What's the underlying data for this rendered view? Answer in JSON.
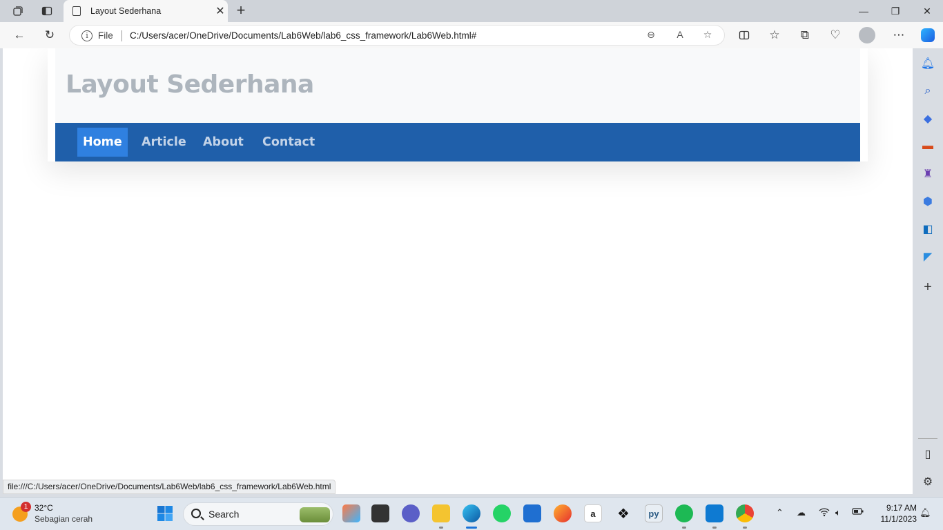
{
  "browser": {
    "tab_title": "Layout Sederhana",
    "address_scheme": "File",
    "address_url": "C:/Users/acer/OneDrive/Documents/Lab6Web/lab6_css_framework/Lab6Web.html#",
    "status_url": "file:///C:/Users/acer/OneDrive/Documents/Lab6Web/lab6_css_framework/Lab6Web.html"
  },
  "page": {
    "site_title": "Layout Sederhana",
    "nav": [
      {
        "label": "Home",
        "active": true
      },
      {
        "label": "Article",
        "active": false
      },
      {
        "label": "About",
        "active": false
      },
      {
        "label": "Contact",
        "active": false
      }
    ]
  },
  "taskbar": {
    "weather_temp": "32°C",
    "weather_desc": "Sebagian cerah",
    "weather_badge": "1",
    "search_placeholder": "Search",
    "time": "9:17 AM",
    "date": "11/1/2023",
    "apps": [
      "file-explorer-copilot-icon",
      "task-view-icon",
      "teams-icon",
      "file-explorer-icon",
      "edge-icon",
      "whatsapp-icon",
      "store-icon",
      "firefox-icon",
      "amazon-icon",
      "dropbox-icon",
      "python-icon",
      "spotify-icon",
      "vscode-icon",
      "chrome-icon"
    ]
  },
  "colors": {
    "nav_bg": "#1f5faa",
    "nav_active": "#2f80e0",
    "header_text": "#adb5bd"
  }
}
